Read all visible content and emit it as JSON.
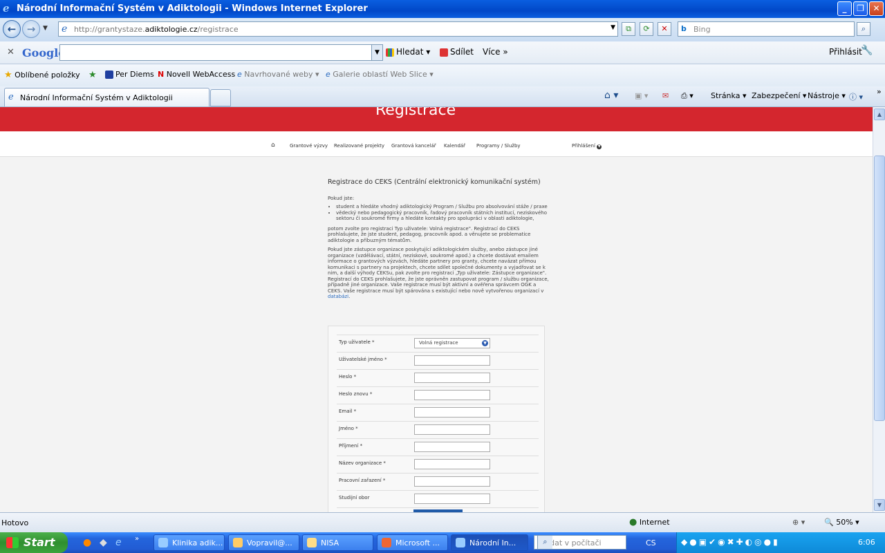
{
  "window": {
    "title": "Národní Informační Systém v Adiktologii - Windows Internet Explorer"
  },
  "address": {
    "prefix": "http://grantystaze.",
    "domain": "adiktologie.cz",
    "path": "/registrace"
  },
  "search": {
    "placeholder": "Bing"
  },
  "google": {
    "logo": "Google",
    "search_label": "Hledat",
    "share_label": "Sdílet",
    "more_label": "Více",
    "login_label": "Přihlásit"
  },
  "favorites": {
    "label": "Oblíbené položky",
    "items": [
      "Per Diems",
      "Novell WebAccess",
      "Navrhované weby",
      "Galerie oblastí Web Slice"
    ]
  },
  "tab": {
    "title": "Národní Informační Systém v Adiktologii"
  },
  "commands": {
    "page": "Stránka",
    "security": "Zabezpečení",
    "tools": "Nástroje"
  },
  "page": {
    "header": "Registrace",
    "menu": [
      "Grantové výzvy",
      "Realizované projekty",
      "Grantová kancelář",
      "Kalendář",
      "Programy / Služby"
    ],
    "login": "Přihlášení",
    "heading": "Registrace do CEKS (Centrální elektronický komunikační systém)",
    "intro": "Pokud jste:",
    "bullet1": "student a hledáte vhodný adiktologický Program / Službu pro absolvování stáže / praxe",
    "bullet2": "vědecký nebo pedagogický pracovník, řadový pracovník státních institucí, neziskového sektoru či soukromé firmy a hledáte kontakty pro spolupráci v oblasti adiktologie,",
    "para1": "potom zvolte pro registraci Typ uživatele: Volná registrace\". Registrací do CEKS prohlašujete, že jste student, pedagog, pracovník apod. a věnujete se problematice adiktologie a příbuzným tématům.",
    "para2": "Pokud jste zástupce organizace poskytující adiktologickém služby, anebo zástupce jiné organizace (vzdělávací, státní, neziskové, soukromé apod.) a chcete dostávat emailem informace o grantových výzvách, hledáte partnery pro granty, chcete navázat přímou komunikaci s partnery na projektech, chcete sdílet společné dokumenty a vyjadřovat se k nim, a další výhody CEKSu, pak zvolte pro registraci „Typ uživatele: Zástupce organizace\". Registrací do CEKS prohlašujete, že jste oprávněn zastupovat program / službu organizace, případně jiné organizace. Vaše registrace musí být aktivní a ověřena správcem OGK a CEKS. Vaše registrace musí být spárována s existující nebo nově vytvořenou organizací v",
    "para2_link": "databázi",
    "form": {
      "fields": [
        {
          "label": "Typ uživatele *",
          "value": "Volná registrace"
        },
        {
          "label": "Uživatelské jméno *"
        },
        {
          "label": "Heslo *"
        },
        {
          "label": "Heslo znovu *"
        },
        {
          "label": "Email *"
        },
        {
          "label": "Jméno *"
        },
        {
          "label": "Příjmení *"
        },
        {
          "label": "Název organizace *"
        },
        {
          "label": "Pracovní zařazení *"
        },
        {
          "label": "Studijní obor"
        }
      ]
    }
  },
  "status": {
    "left": "Hotovo",
    "zone": "Internet",
    "zoom": "50%"
  },
  "taskbar": {
    "start": "Start",
    "items": [
      "Klinika adik...",
      "Vopravil@...",
      "NISA",
      "Microsoft ...",
      "Národní In..."
    ],
    "search_placeholder": "Hledat v počítači",
    "lang": "CS",
    "clock": "6:06"
  }
}
